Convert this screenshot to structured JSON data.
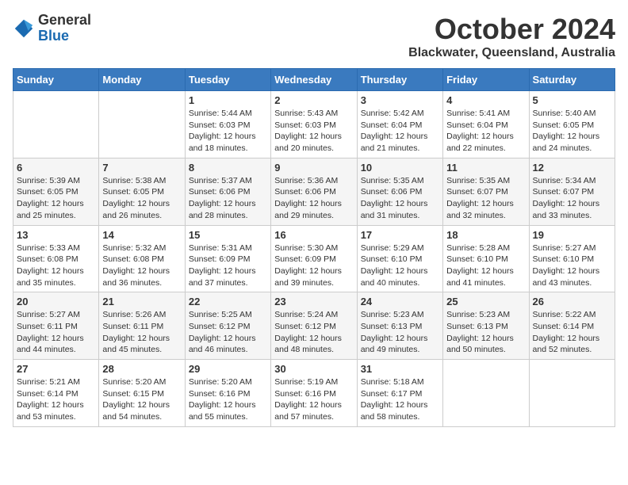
{
  "logo": {
    "general": "General",
    "blue": "Blue"
  },
  "header": {
    "month": "October 2024",
    "location": "Blackwater, Queensland, Australia"
  },
  "weekdays": [
    "Sunday",
    "Monday",
    "Tuesday",
    "Wednesday",
    "Thursday",
    "Friday",
    "Saturday"
  ],
  "weeks": [
    [
      {
        "day": "",
        "info": ""
      },
      {
        "day": "",
        "info": ""
      },
      {
        "day": "1",
        "sunrise": "5:44 AM",
        "sunset": "6:03 PM",
        "daylight": "12 hours and 18 minutes."
      },
      {
        "day": "2",
        "sunrise": "5:43 AM",
        "sunset": "6:03 PM",
        "daylight": "12 hours and 20 minutes."
      },
      {
        "day": "3",
        "sunrise": "5:42 AM",
        "sunset": "6:04 PM",
        "daylight": "12 hours and 21 minutes."
      },
      {
        "day": "4",
        "sunrise": "5:41 AM",
        "sunset": "6:04 PM",
        "daylight": "12 hours and 22 minutes."
      },
      {
        "day": "5",
        "sunrise": "5:40 AM",
        "sunset": "6:05 PM",
        "daylight": "12 hours and 24 minutes."
      }
    ],
    [
      {
        "day": "6",
        "sunrise": "5:39 AM",
        "sunset": "6:05 PM",
        "daylight": "12 hours and 25 minutes."
      },
      {
        "day": "7",
        "sunrise": "5:38 AM",
        "sunset": "6:05 PM",
        "daylight": "12 hours and 26 minutes."
      },
      {
        "day": "8",
        "sunrise": "5:37 AM",
        "sunset": "6:06 PM",
        "daylight": "12 hours and 28 minutes."
      },
      {
        "day": "9",
        "sunrise": "5:36 AM",
        "sunset": "6:06 PM",
        "daylight": "12 hours and 29 minutes."
      },
      {
        "day": "10",
        "sunrise": "5:35 AM",
        "sunset": "6:06 PM",
        "daylight": "12 hours and 31 minutes."
      },
      {
        "day": "11",
        "sunrise": "5:35 AM",
        "sunset": "6:07 PM",
        "daylight": "12 hours and 32 minutes."
      },
      {
        "day": "12",
        "sunrise": "5:34 AM",
        "sunset": "6:07 PM",
        "daylight": "12 hours and 33 minutes."
      }
    ],
    [
      {
        "day": "13",
        "sunrise": "5:33 AM",
        "sunset": "6:08 PM",
        "daylight": "12 hours and 35 minutes."
      },
      {
        "day": "14",
        "sunrise": "5:32 AM",
        "sunset": "6:08 PM",
        "daylight": "12 hours and 36 minutes."
      },
      {
        "day": "15",
        "sunrise": "5:31 AM",
        "sunset": "6:09 PM",
        "daylight": "12 hours and 37 minutes."
      },
      {
        "day": "16",
        "sunrise": "5:30 AM",
        "sunset": "6:09 PM",
        "daylight": "12 hours and 39 minutes."
      },
      {
        "day": "17",
        "sunrise": "5:29 AM",
        "sunset": "6:10 PM",
        "daylight": "12 hours and 40 minutes."
      },
      {
        "day": "18",
        "sunrise": "5:28 AM",
        "sunset": "6:10 PM",
        "daylight": "12 hours and 41 minutes."
      },
      {
        "day": "19",
        "sunrise": "5:27 AM",
        "sunset": "6:10 PM",
        "daylight": "12 hours and 43 minutes."
      }
    ],
    [
      {
        "day": "20",
        "sunrise": "5:27 AM",
        "sunset": "6:11 PM",
        "daylight": "12 hours and 44 minutes."
      },
      {
        "day": "21",
        "sunrise": "5:26 AM",
        "sunset": "6:11 PM",
        "daylight": "12 hours and 45 minutes."
      },
      {
        "day": "22",
        "sunrise": "5:25 AM",
        "sunset": "6:12 PM",
        "daylight": "12 hours and 46 minutes."
      },
      {
        "day": "23",
        "sunrise": "5:24 AM",
        "sunset": "6:12 PM",
        "daylight": "12 hours and 48 minutes."
      },
      {
        "day": "24",
        "sunrise": "5:23 AM",
        "sunset": "6:13 PM",
        "daylight": "12 hours and 49 minutes."
      },
      {
        "day": "25",
        "sunrise": "5:23 AM",
        "sunset": "6:13 PM",
        "daylight": "12 hours and 50 minutes."
      },
      {
        "day": "26",
        "sunrise": "5:22 AM",
        "sunset": "6:14 PM",
        "daylight": "12 hours and 52 minutes."
      }
    ],
    [
      {
        "day": "27",
        "sunrise": "5:21 AM",
        "sunset": "6:14 PM",
        "daylight": "12 hours and 53 minutes."
      },
      {
        "day": "28",
        "sunrise": "5:20 AM",
        "sunset": "6:15 PM",
        "daylight": "12 hours and 54 minutes."
      },
      {
        "day": "29",
        "sunrise": "5:20 AM",
        "sunset": "6:16 PM",
        "daylight": "12 hours and 55 minutes."
      },
      {
        "day": "30",
        "sunrise": "5:19 AM",
        "sunset": "6:16 PM",
        "daylight": "12 hours and 57 minutes."
      },
      {
        "day": "31",
        "sunrise": "5:18 AM",
        "sunset": "6:17 PM",
        "daylight": "12 hours and 58 minutes."
      },
      {
        "day": "",
        "info": ""
      },
      {
        "day": "",
        "info": ""
      }
    ]
  ]
}
